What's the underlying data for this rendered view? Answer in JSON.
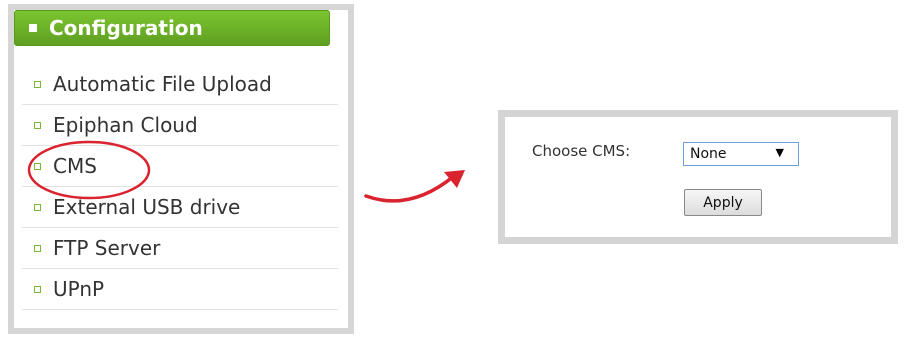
{
  "menu": {
    "title": "Configuration",
    "items": [
      {
        "label": "Automatic File Upload"
      },
      {
        "label": "Epiphan Cloud"
      },
      {
        "label": "CMS"
      },
      {
        "label": "External USB drive"
      },
      {
        "label": "FTP Server"
      },
      {
        "label": "UPnP"
      }
    ]
  },
  "cms_settings": {
    "choose_label": "Choose CMS:",
    "selected": "None",
    "apply_label": "Apply"
  },
  "colors": {
    "header_green": "#6db32a",
    "annotation_red": "#d9232e",
    "panel_border": "#d4d4d4"
  }
}
